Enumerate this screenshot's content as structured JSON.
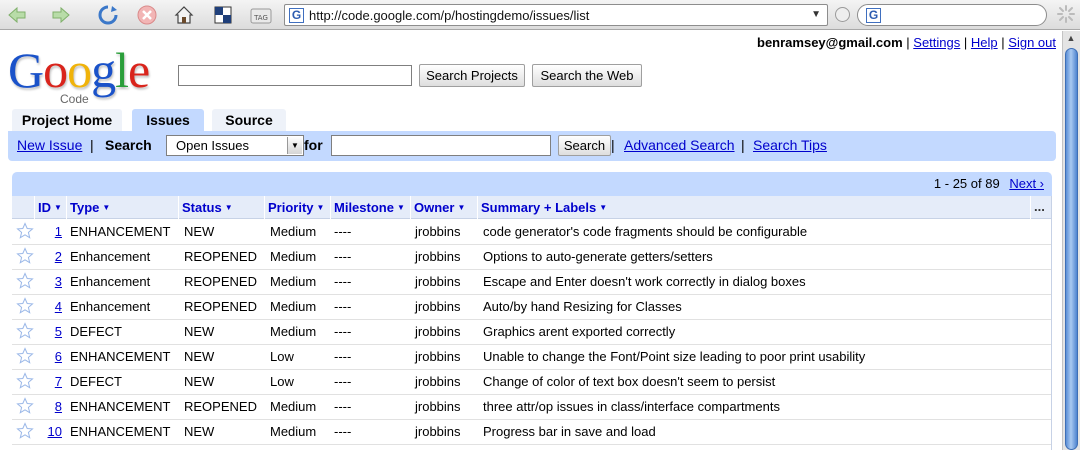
{
  "browser": {
    "url": "http://code.google.com/p/hostingdemo/issues/list",
    "url_favicon": "G",
    "search_engine": "G",
    "icons": [
      "back-icon",
      "forward-icon",
      "reload-icon",
      "stop-icon",
      "home-icon",
      "bookmark-icon",
      "tag-icon"
    ]
  },
  "header": {
    "user_email": "benramsey@gmail.com",
    "links": [
      "Settings",
      "Help",
      "Sign out"
    ],
    "separator": "|",
    "logo_text": "Google",
    "logo_sub": "Code",
    "search_projects_label": "Search Projects",
    "search_web_label": "Search the Web"
  },
  "tabs": [
    "Project Home",
    "Issues",
    "Source"
  ],
  "issue_search": {
    "new_issue": "New Issue",
    "search_label": "Search",
    "scope": "Open Issues",
    "for_label": "for",
    "query": "",
    "search_button": "Search",
    "advanced_search": "Advanced Search",
    "search_tips": "Search Tips"
  },
  "results": {
    "range": "1 - 25 of 89",
    "next": "Next ›",
    "columns": [
      "ID",
      "Type",
      "Status",
      "Priority",
      "Milestone",
      "Owner",
      "Summary + Labels"
    ],
    "more": "...",
    "rows": [
      {
        "id": "1",
        "type": "ENHANCEMENT",
        "status": "NEW",
        "priority": "Medium",
        "milestone": "----",
        "owner": "jrobbins",
        "summary": "code generator's code fragments should be configurable"
      },
      {
        "id": "2",
        "type": "Enhancement",
        "status": "REOPENED",
        "priority": "Medium",
        "milestone": "----",
        "owner": "jrobbins",
        "summary": "Options to auto-generate getters/setters"
      },
      {
        "id": "3",
        "type": "Enhancement",
        "status": "REOPENED",
        "priority": "Medium",
        "milestone": "----",
        "owner": "jrobbins",
        "summary": "Escape and Enter doesn't work correctly in dialog boxes"
      },
      {
        "id": "4",
        "type": "Enhancement",
        "status": "REOPENED",
        "priority": "Medium",
        "milestone": "----",
        "owner": "jrobbins",
        "summary": "Auto/by hand Resizing for Classes"
      },
      {
        "id": "5",
        "type": "DEFECT",
        "status": "NEW",
        "priority": "Medium",
        "milestone": "----",
        "owner": "jrobbins",
        "summary": "Graphics arent exported correctly"
      },
      {
        "id": "6",
        "type": "ENHANCEMENT",
        "status": "NEW",
        "priority": "Low",
        "milestone": "----",
        "owner": "jrobbins",
        "summary": "Unable to change the Font/Point size leading to poor print usability"
      },
      {
        "id": "7",
        "type": "DEFECT",
        "status": "NEW",
        "priority": "Low",
        "milestone": "----",
        "owner": "jrobbins",
        "summary": "Change of color of text box doesn't seem to persist"
      },
      {
        "id": "8",
        "type": "ENHANCEMENT",
        "status": "REOPENED",
        "priority": "Medium",
        "milestone": "----",
        "owner": "jrobbins",
        "summary": "three attr/op issues in class/interface compartments"
      },
      {
        "id": "10",
        "type": "ENHANCEMENT",
        "status": "NEW",
        "priority": "Medium",
        "milestone": "----",
        "owner": "jrobbins",
        "summary": "Progress bar in save and load"
      }
    ]
  },
  "colors": {
    "accent_blue": "#c3d9ff",
    "link": "#0000cc",
    "google_blue": "#1a52c9",
    "google_red": "#d9241c",
    "google_yellow": "#f0b30a",
    "google_green": "#2a9e3a"
  }
}
